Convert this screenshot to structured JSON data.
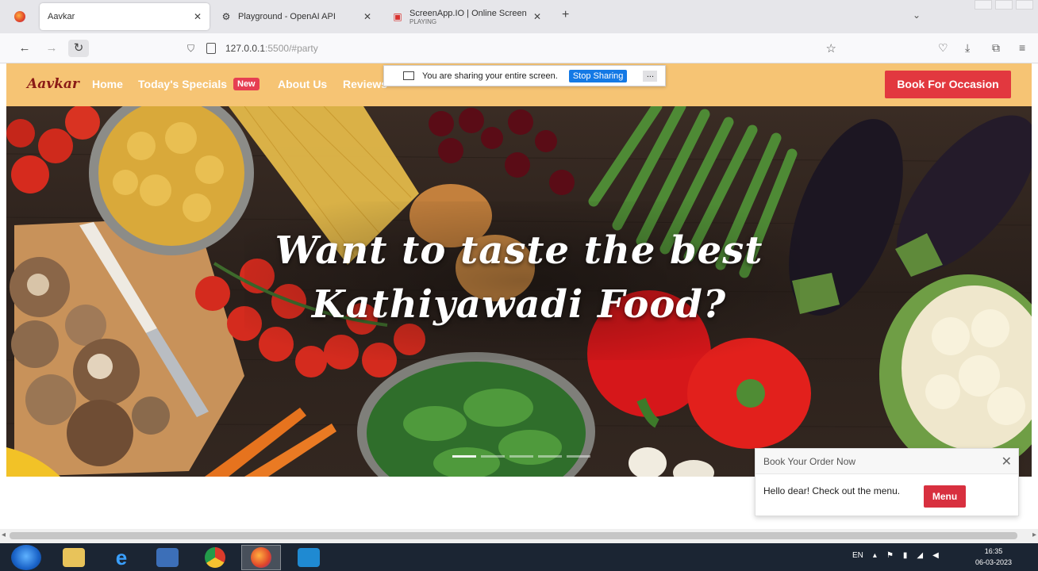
{
  "browser": {
    "tabs": [
      {
        "title": "Aavkar",
        "subtitle": "",
        "active": true
      },
      {
        "title": "Playground - OpenAI API",
        "subtitle": "",
        "active": false
      },
      {
        "title": "ScreenApp.IO | Online Screen R...",
        "subtitle": "PLAYING",
        "active": false
      }
    ],
    "new_tab": "+",
    "url_host": "127.0.0.1",
    "url_path": ":5500/#party"
  },
  "share_notice": {
    "text": "You are sharing your entire screen.",
    "stop_label": "Stop Sharing",
    "more_label": "..."
  },
  "site": {
    "logo": "Aavkar",
    "nav": {
      "home": "Home",
      "specials": "Today's Specials",
      "new_badge": "New",
      "about": "About Us",
      "reviews": "Reviews"
    },
    "book_button": "Book For Occasion"
  },
  "hero": {
    "heading_line1": "Want to taste the best",
    "heading_line2": "Kathiyawadi Food?",
    "slide_count": 5,
    "active_slide": 0
  },
  "toast": {
    "title": "Book Your Order Now",
    "message": "Hello dear! Check out the menu.",
    "button": "Menu"
  },
  "taskbar": {
    "language": "EN",
    "time": "16:35",
    "date": "06-03-2023"
  },
  "colors": {
    "header_bg": "#f6c474",
    "accent_red": "#e2383f",
    "new_badge": "#e63e52"
  }
}
